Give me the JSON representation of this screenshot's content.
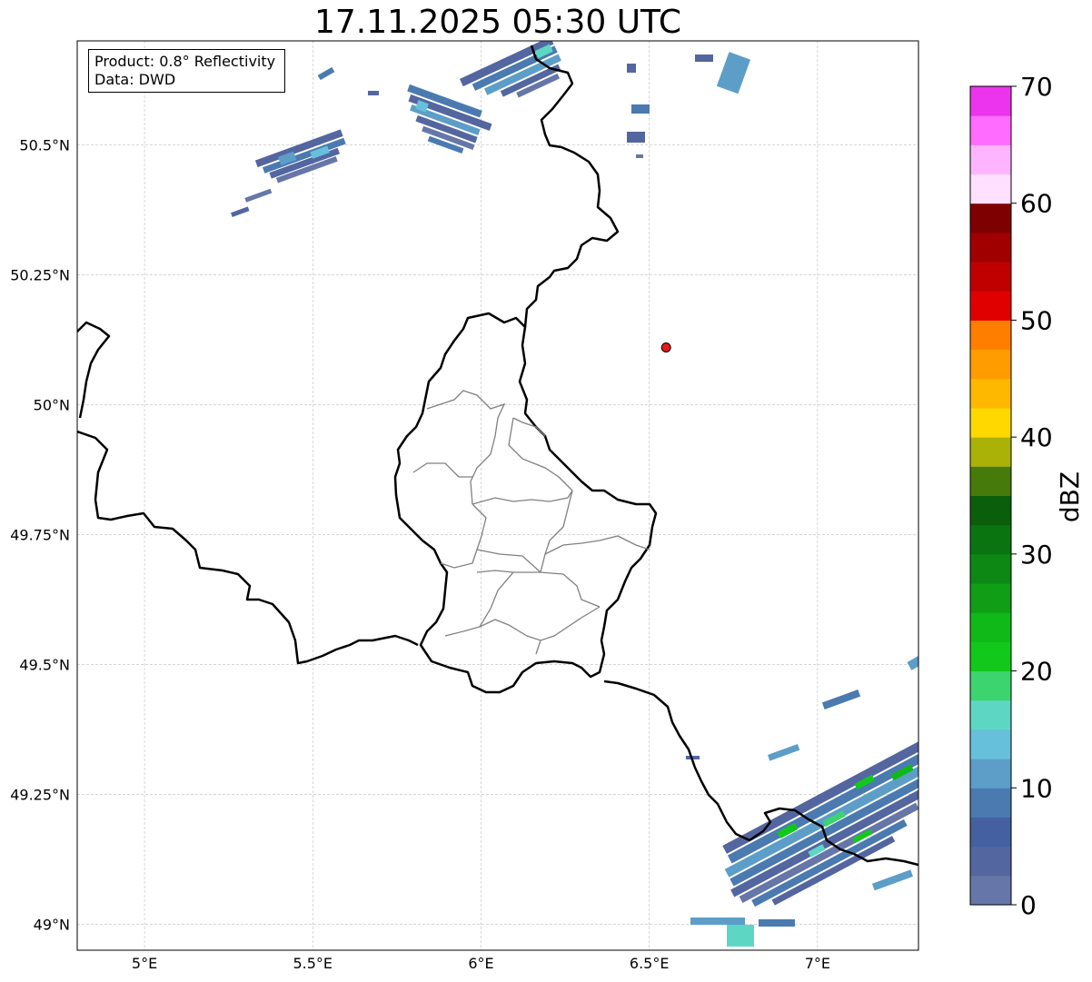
{
  "title": "17.11.2025 05:30 UTC",
  "info": {
    "product": "Product: 0.8° Reflectivity",
    "data_source": "Data: DWD"
  },
  "map": {
    "lon_range": [
      4.8,
      7.3
    ],
    "lat_range": [
      48.95,
      50.7
    ],
    "lon_ticks": [
      {
        "value": 5.0,
        "label": "5°E"
      },
      {
        "value": 5.5,
        "label": "5.5°E"
      },
      {
        "value": 6.0,
        "label": "6°E"
      },
      {
        "value": 6.5,
        "label": "6.5°E"
      },
      {
        "value": 7.0,
        "label": "7°E"
      }
    ],
    "lat_ticks": [
      {
        "value": 49.0,
        "label": "49°N"
      },
      {
        "value": 49.25,
        "label": "49.25°N"
      },
      {
        "value": 49.5,
        "label": "49.5°N"
      },
      {
        "value": 49.75,
        "label": "49.75°N"
      },
      {
        "value": 50.0,
        "label": "50°N"
      },
      {
        "value": 50.25,
        "label": "50.25°N"
      },
      {
        "value": 50.5,
        "label": "50.5°N"
      }
    ],
    "gridlines": "dashed",
    "radar_marker": {
      "lon": 6.55,
      "lat": 50.11,
      "color": "#e21b1b"
    }
  },
  "colorbar": {
    "label": "dBZ",
    "min": 0,
    "max": 70,
    "ticks": [
      {
        "value": 0,
        "label": "0"
      },
      {
        "value": 10,
        "label": "10"
      },
      {
        "value": 20,
        "label": "20"
      },
      {
        "value": 30,
        "label": "30"
      },
      {
        "value": 40,
        "label": "40"
      },
      {
        "value": 50,
        "label": "50"
      },
      {
        "value": 60,
        "label": "60"
      },
      {
        "value": 70,
        "label": "70"
      }
    ],
    "colors": [
      "#6676a8",
      "#5466a0",
      "#4460a0",
      "#4a7ab0",
      "#5c9ec8",
      "#66c0dc",
      "#5ed6c4",
      "#3cd46e",
      "#12c81a",
      "#10b818",
      "#0f9e16",
      "#0e8814",
      "#0a7410",
      "#0a5e0c",
      "#467a0a",
      "#aab208",
      "#ffd800",
      "#ffb800",
      "#ff9c00",
      "#ff7e00",
      "#e00000",
      "#c00000",
      "#a00000",
      "#7e0000",
      "#ffe0ff",
      "#ffb4ff",
      "#ff6cff",
      "#ec34ec"
    ]
  }
}
